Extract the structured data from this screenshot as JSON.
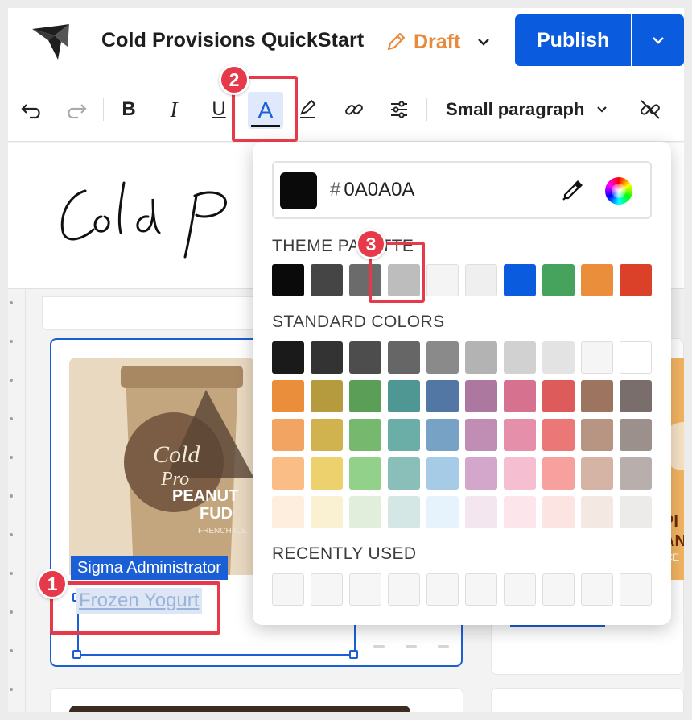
{
  "header": {
    "app_title": "Cold Provisions QuickStart",
    "draft_label": "Draft",
    "publish_label": "Publish"
  },
  "toolbar": {
    "bold": "B",
    "italic": "I",
    "underline": "U",
    "font_color": "A",
    "text_style": "Small paragraph"
  },
  "canvas": {
    "admin_tag": "Sigma Administrator",
    "selected_text": "Frozen Yogurt",
    "product_label_1": "PEANUT",
    "product_label_2": "FUD",
    "product_label_3": "FRENCH ICE",
    "script_logo_text": "Cold Pr"
  },
  "color_picker": {
    "hex_value": "0A0A0A",
    "hash": "#",
    "theme_label": "THEME PALETTE",
    "standard_label": "STANDARD COLORS",
    "recent_label": "RECENTLY USED",
    "current_color": "#0A0A0A",
    "theme_palette": [
      "#0A0A0A",
      "#454545",
      "#6B6B6B",
      "#BDBDBD",
      "#F4F4F4",
      "#EFEFEF",
      "#0B5BDE",
      "#46A35E",
      "#EB8E3C",
      "#DA4128"
    ],
    "standard_colors": [
      [
        "#1A1A1A",
        "#333333",
        "#4D4D4D",
        "#666666",
        "#8A8A8A",
        "#B3B3B3",
        "#D1D1D1",
        "#E3E3E3",
        "#F5F5F5",
        "#FFFFFF"
      ],
      [
        "#EB8E3C",
        "#B59B3D",
        "#5A9E58",
        "#4F9793",
        "#5277A4",
        "#AC78A0",
        "#D6728F",
        "#DE5B5B",
        "#9C7460",
        "#7A6E6C"
      ],
      [
        "#F2A462",
        "#D0B34F",
        "#75B86E",
        "#6BADA7",
        "#78A1C6",
        "#C08DB5",
        "#E68FAB",
        "#EB7877",
        "#B89483",
        "#9C908D"
      ],
      [
        "#FABD85",
        "#EDD16C",
        "#92D189",
        "#8ABEB9",
        "#A6CBE6",
        "#D3A6CB",
        "#F6BFD1",
        "#F7A09E",
        "#D5B3A5",
        "#B8AFAC"
      ],
      [
        "#FEEEDE",
        "#FAF0D2",
        "#E0EEDB",
        "#D4E7E5",
        "#E6F2FC",
        "#F4E6EF",
        "#FCE6EC",
        "#FCE4E3",
        "#F4E8E3",
        "#ECEBEA"
      ]
    ],
    "recently_used": [
      "#F6F6F6",
      "#F6F6F6",
      "#F6F6F6",
      "#F6F6F6",
      "#F6F6F6",
      "#F6F6F6",
      "#F6F6F6",
      "#F6F6F6",
      "#F6F6F6",
      "#F6F6F6"
    ]
  },
  "callouts": [
    "1",
    "2",
    "3"
  ],
  "accent_color": "#0B5BDE",
  "draft_color": "#E8893B",
  "callout_color": "#E63A4A"
}
